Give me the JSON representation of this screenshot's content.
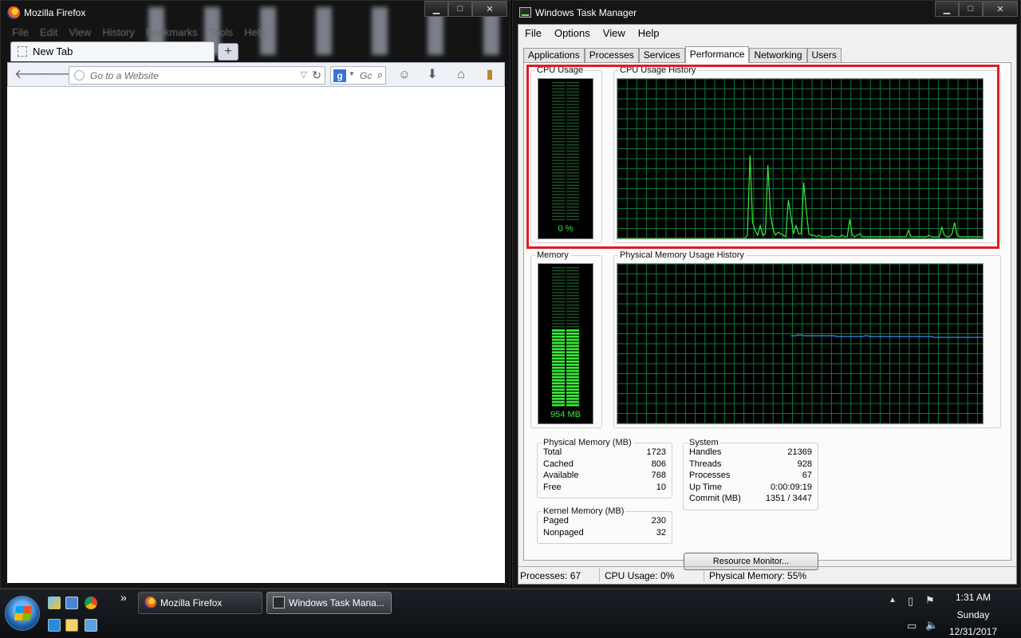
{
  "firefox": {
    "title": "Mozilla Firefox",
    "menu": [
      "File",
      "Edit",
      "View",
      "History",
      "Bookmarks",
      "Tools",
      "Help"
    ],
    "tab_label": "New Tab",
    "new_tab_symbol": "+",
    "url_placeholder": "Go to a Website",
    "search_placeholder": "Gc",
    "icons": [
      "firefox-icon",
      "back-icon",
      "forward-icon",
      "reload-icon",
      "google-icon",
      "search-icon",
      "addon-icon",
      "download-icon",
      "home-icon",
      "bookmarks-icon"
    ]
  },
  "taskmgr": {
    "title": "Windows Task Manager",
    "menu": [
      "File",
      "Options",
      "View",
      "Help"
    ],
    "tabs": [
      "Applications",
      "Processes",
      "Services",
      "Performance",
      "Networking",
      "Users"
    ],
    "active_tab": "Performance",
    "cpu_usage": {
      "label": "CPU Usage",
      "value": "0 %",
      "fraction": 0.0
    },
    "cpu_history": {
      "label": "CPU Usage History",
      "points": [
        0,
        0,
        0,
        0,
        0,
        0,
        0,
        0,
        0,
        0,
        0,
        0,
        0,
        0,
        0,
        0,
        0,
        0,
        0,
        0,
        0,
        0,
        0,
        0,
        0,
        0,
        0,
        0,
        0,
        0,
        0,
        0,
        0,
        0,
        0,
        0,
        0,
        0,
        0,
        0,
        0,
        0,
        0,
        0,
        0,
        0,
        0,
        0,
        0,
        0,
        0,
        0,
        0,
        0,
        0,
        0,
        0,
        0,
        0,
        0,
        0,
        0,
        0,
        0,
        0,
        0,
        0,
        2,
        52,
        10,
        5,
        2,
        8,
        2,
        3,
        46,
        15,
        6,
        2,
        4,
        3,
        2,
        1,
        24,
        14,
        3,
        8,
        3,
        3,
        35,
        18,
        3,
        2,
        2,
        1,
        2,
        1,
        1,
        1,
        1,
        2,
        1,
        1,
        1,
        2,
        1,
        1,
        12,
        2,
        1,
        2,
        3,
        1,
        1,
        1,
        1,
        1,
        1,
        1,
        1,
        1,
        1,
        1,
        1,
        1,
        1,
        1,
        1,
        1,
        1,
        5,
        1,
        1,
        1,
        1,
        1,
        1,
        1,
        2,
        1,
        1,
        1,
        1,
        7,
        2,
        1,
        1,
        3,
        10,
        2,
        1,
        1,
        1,
        1,
        1,
        1,
        1,
        1,
        1,
        1
      ]
    },
    "memory": {
      "label": "Memory",
      "value": "954 MB",
      "fraction": 0.55
    },
    "memory_history": {
      "label": "Physical Memory Usage History",
      "points": [
        55,
        55,
        55,
        55.5,
        55.5,
        55,
        55,
        55,
        55,
        55,
        55,
        55,
        55,
        55,
        55,
        55,
        55,
        55,
        54.5,
        54.5,
        54.5,
        54.5,
        54.5,
        54.5,
        54.5,
        54.5,
        54.5,
        54.5,
        54.5,
        55,
        55,
        54.5,
        54.5,
        54.5,
        54.5,
        54.5,
        54.5,
        54.5,
        54.5,
        54.5,
        54.5,
        54.5,
        54.5,
        54.5,
        54.5,
        54.5,
        54.5,
        54.5,
        54.5,
        54.5,
        54.5,
        54.5,
        54.5,
        54.5,
        54.5,
        54.5,
        54,
        54,
        54,
        54,
        54,
        54,
        54,
        54,
        54,
        54,
        54,
        54,
        54,
        54,
        54,
        54,
        54,
        54,
        54,
        54
      ]
    },
    "physical_memory": {
      "label": "Physical Memory (MB)",
      "rows": [
        {
          "k": "Total",
          "v": "1723"
        },
        {
          "k": "Cached",
          "v": "806"
        },
        {
          "k": "Available",
          "v": "768"
        },
        {
          "k": "Free",
          "v": "10"
        }
      ]
    },
    "kernel_memory": {
      "label": "Kernel Memory (MB)",
      "rows": [
        {
          "k": "Paged",
          "v": "230"
        },
        {
          "k": "Nonpaged",
          "v": "32"
        }
      ]
    },
    "system": {
      "label": "System",
      "rows": [
        {
          "k": "Handles",
          "v": "21369"
        },
        {
          "k": "Threads",
          "v": "928"
        },
        {
          "k": "Processes",
          "v": "67"
        },
        {
          "k": "Up Time",
          "v": "0:00:09:19"
        },
        {
          "k": "Commit (MB)",
          "v": "1351 / 3447"
        }
      ]
    },
    "resource_monitor_label": "Resource Monitor...",
    "status": {
      "processes": "Processes: 67",
      "cpu": "CPU Usage: 0%",
      "memory": "Physical Memory: 55%"
    },
    "colors": {
      "graph_green": "#38e838",
      "grid": "#0a7a3a",
      "memory_line": "#3a8df0",
      "highlight": "#e01c24"
    }
  },
  "taskbar": {
    "overflow": "»",
    "buttons": [
      "Mozilla Firefox",
      "Windows Task Mana..."
    ],
    "clock_time": "1:31 AM",
    "clock_day": "Sunday",
    "clock_date": "12/31/2017"
  }
}
